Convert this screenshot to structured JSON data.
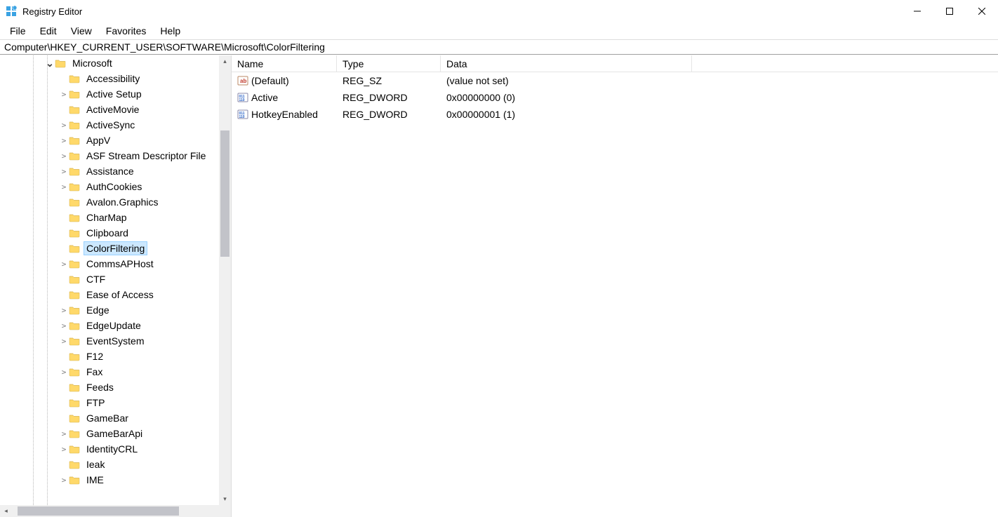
{
  "window": {
    "title": "Registry Editor"
  },
  "menu": {
    "items": [
      "File",
      "Edit",
      "View",
      "Favorites",
      "Help"
    ]
  },
  "addressbar": {
    "path": "Computer\\HKEY_CURRENT_USER\\SOFTWARE\\Microsoft\\ColorFiltering"
  },
  "tree": {
    "items": [
      {
        "depth": 3,
        "twisty": "expanded",
        "label": "Microsoft",
        "selected": false
      },
      {
        "depth": 4,
        "twisty": "none",
        "label": "Accessibility"
      },
      {
        "depth": 4,
        "twisty": "collapsed",
        "label": "Active Setup"
      },
      {
        "depth": 4,
        "twisty": "none",
        "label": "ActiveMovie"
      },
      {
        "depth": 4,
        "twisty": "collapsed",
        "label": "ActiveSync"
      },
      {
        "depth": 4,
        "twisty": "collapsed",
        "label": "AppV"
      },
      {
        "depth": 4,
        "twisty": "collapsed",
        "label": "ASF Stream Descriptor File"
      },
      {
        "depth": 4,
        "twisty": "collapsed",
        "label": "Assistance"
      },
      {
        "depth": 4,
        "twisty": "collapsed",
        "label": "AuthCookies"
      },
      {
        "depth": 4,
        "twisty": "none",
        "label": "Avalon.Graphics"
      },
      {
        "depth": 4,
        "twisty": "none",
        "label": "CharMap"
      },
      {
        "depth": 4,
        "twisty": "none",
        "label": "Clipboard"
      },
      {
        "depth": 4,
        "twisty": "none",
        "label": "ColorFiltering",
        "selected": true
      },
      {
        "depth": 4,
        "twisty": "collapsed",
        "label": "CommsAPHost"
      },
      {
        "depth": 4,
        "twisty": "none",
        "label": "CTF"
      },
      {
        "depth": 4,
        "twisty": "none",
        "label": "Ease of Access"
      },
      {
        "depth": 4,
        "twisty": "collapsed",
        "label": "Edge"
      },
      {
        "depth": 4,
        "twisty": "collapsed",
        "label": "EdgeUpdate"
      },
      {
        "depth": 4,
        "twisty": "collapsed",
        "label": "EventSystem"
      },
      {
        "depth": 4,
        "twisty": "none",
        "label": "F12"
      },
      {
        "depth": 4,
        "twisty": "collapsed",
        "label": "Fax"
      },
      {
        "depth": 4,
        "twisty": "none",
        "label": "Feeds"
      },
      {
        "depth": 4,
        "twisty": "none",
        "label": "FTP"
      },
      {
        "depth": 4,
        "twisty": "none",
        "label": "GameBar"
      },
      {
        "depth": 4,
        "twisty": "collapsed",
        "label": "GameBarApi"
      },
      {
        "depth": 4,
        "twisty": "collapsed",
        "label": "IdentityCRL"
      },
      {
        "depth": 4,
        "twisty": "none",
        "label": "Ieak"
      },
      {
        "depth": 4,
        "twisty": "collapsed",
        "label": "IME"
      }
    ]
  },
  "values": {
    "headers": {
      "name": "Name",
      "type": "Type",
      "data": "Data"
    },
    "rows": [
      {
        "icon": "sz",
        "name": "(Default)",
        "type": "REG_SZ",
        "data": "(value not set)"
      },
      {
        "icon": "dword",
        "name": "Active",
        "type": "REG_DWORD",
        "data": "0x00000000 (0)"
      },
      {
        "icon": "dword",
        "name": "HotkeyEnabled",
        "type": "REG_DWORD",
        "data": "0x00000001 (1)"
      }
    ]
  }
}
